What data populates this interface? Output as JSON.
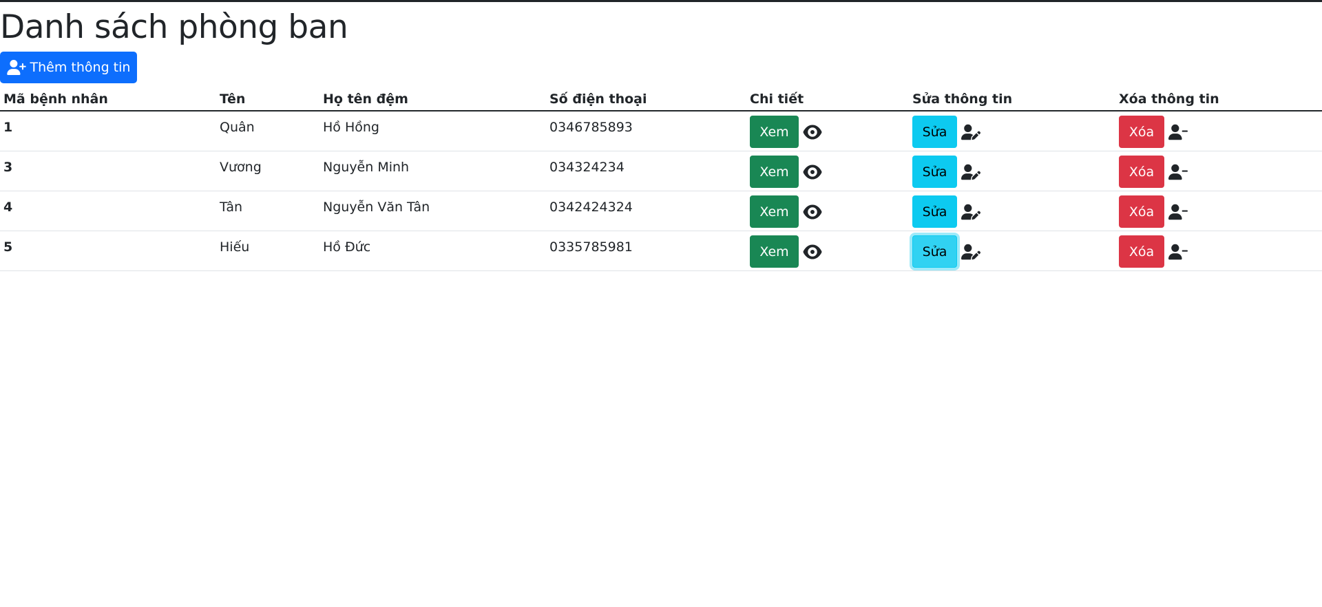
{
  "page": {
    "title": "Danh sách phòng ban",
    "add_button": "Thêm thông tin"
  },
  "table": {
    "headers": [
      "Mã bệnh nhân",
      "Tên",
      "Họ tên đệm",
      "Số điện thoại",
      "Chi tiết",
      "Sửa thông tin",
      "Xóa thông tin"
    ],
    "rows": [
      {
        "id": "1",
        "ten": "Quân",
        "ho_ten_dem": "Hồ Hồng",
        "sdt": "0346785893"
      },
      {
        "id": "3",
        "ten": "Vương",
        "ho_ten_dem": "Nguyễn Minh",
        "sdt": "034324234"
      },
      {
        "id": "4",
        "ten": "Tân",
        "ho_ten_dem": "Nguyễn Văn Tân",
        "sdt": "0342424324"
      },
      {
        "id": "5",
        "ten": "Hiếu",
        "ho_ten_dem": "Hồ Đức",
        "sdt": "0335785981"
      }
    ],
    "view_label": "Xem",
    "edit_label": "Sửa",
    "delete_label": "Xóa"
  },
  "icons": {
    "add": "user-plus-icon",
    "view": "eye-icon",
    "edit": "user-pen-icon",
    "delete": "user-minus-icon"
  },
  "colors": {
    "primary": "#0d6efd",
    "success": "#198754",
    "info": "#0dcaf0",
    "danger": "#dc3545",
    "text": "#212529"
  }
}
